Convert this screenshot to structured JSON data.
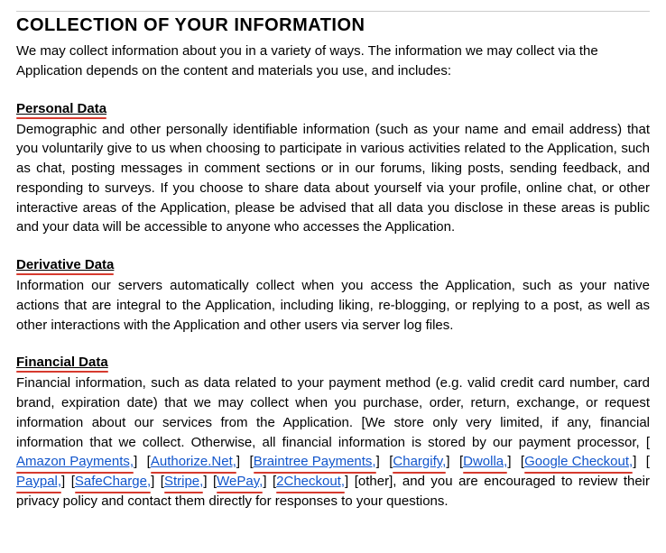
{
  "main_heading": "COLLECTION OF YOUR INFORMATION",
  "intro": "We may collect information about you in a variety of ways.  The information we may collect via the Application depends on the content and materials you use, and includes:",
  "sections": [
    {
      "title": "Personal Data",
      "body_before": "Demographic and other personally identifiable information (such as your name and email address) that you voluntarily give to us when choosing to participate in various activities related to the Application, such as chat, posting messages in comment sections or in our forums, liking posts, sending feedback, and responding to surveys.  If you choose to share data about yourself via your profile, online chat, or other interactive areas of the Application, please be advised that all data you disclose in these areas is public and your data will be accessible to anyone who accesses the Application.",
      "links": [],
      "body_after": ""
    },
    {
      "title": "Derivative Data",
      "body_before": "Information our servers automatically collect when you access the Application, such as your native actions that are integral to the Application, including liking, re-blogging, or replying to a post, as well as other interactions with the Application and other users via server log files.",
      "links": [],
      "body_after": ""
    },
    {
      "title": "Financial Data",
      "body_before": "Financial information, such as data related to your payment method (e.g. valid credit card number, card brand, expiration date) that we may collect when you purchase, order, return, exchange, or request information about our services from the Application. [We store only very limited, if any, financial information that we collect. Otherwise, all financial information is stored by our payment processor, ",
      "links": [
        {
          "text": "Amazon Payments,",
          "prefix": " [",
          "suffix": "]"
        },
        {
          "text": "Authorize.Net,",
          "prefix": " [",
          "suffix": "]"
        },
        {
          "text": "Braintree Payments,",
          "prefix": "  [",
          "suffix": "]"
        },
        {
          "text": "Chargify,",
          "prefix": " [",
          "suffix": "]"
        },
        {
          "text": "Dwolla,",
          "prefix": " [",
          "suffix": "]"
        },
        {
          "text": "Google Checkout,",
          "prefix": " [",
          "suffix": "]"
        },
        {
          "text": "Paypal,",
          "prefix": " [",
          "suffix": "]"
        },
        {
          "text": "SafeCharge,",
          "prefix": " [",
          "suffix": "]"
        },
        {
          "text": "Stripe,",
          "prefix": " [",
          "suffix": "]"
        },
        {
          "text": "WePay,",
          "prefix": " [",
          "suffix": "]"
        },
        {
          "text": "2Checkout,",
          "prefix": " [",
          "suffix": "]"
        }
      ],
      "body_after": " [other], and you are encouraged to review their privacy policy and contact them directly for responses to your questions."
    }
  ]
}
